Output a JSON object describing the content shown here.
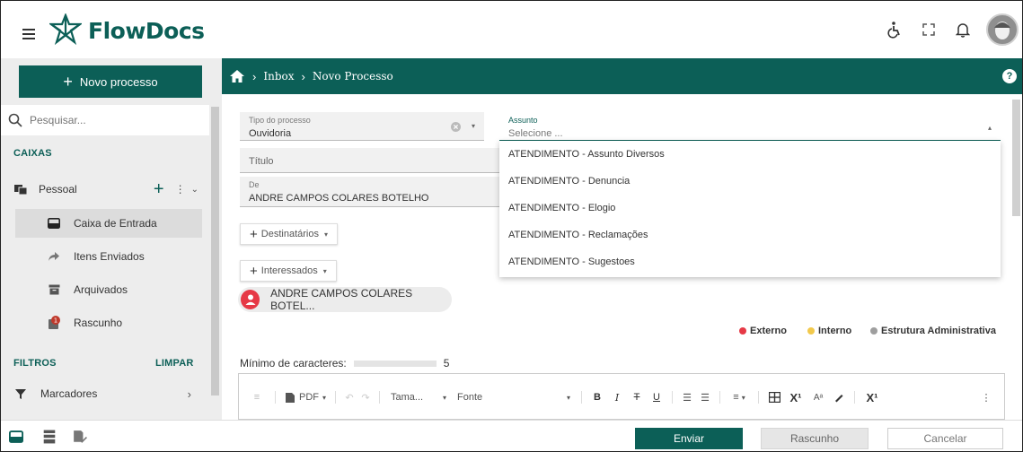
{
  "app": {
    "name": "FlowDocs"
  },
  "header": {
    "icons": [
      "accessibility-icon",
      "fullscreen-icon",
      "bell-icon",
      "user-avatar"
    ]
  },
  "sidebar": {
    "new_process_label": "Novo processo",
    "search_placeholder": "Pesquisar...",
    "caixas_title": "CAIXAS",
    "pessoal_label": "Pessoal",
    "items": [
      {
        "label": "Caixa de Entrada",
        "icon": "inbox-icon",
        "active": true
      },
      {
        "label": "Itens Enviados",
        "icon": "share-icon",
        "active": false
      },
      {
        "label": "Arquivados",
        "icon": "archive-icon",
        "active": false
      },
      {
        "label": "Rascunho",
        "icon": "draft-icon",
        "active": false,
        "badge": "1"
      }
    ],
    "filtros_title": "FILTROS",
    "limpar_label": "LIMPAR",
    "marcadores_label": "Marcadores"
  },
  "breadcrumb": {
    "items": [
      "Inbox",
      "Novo Processo"
    ],
    "help_label": "?"
  },
  "form": {
    "tipo_label": "Tipo do processo",
    "tipo_value": "Ouvidoria",
    "assunto_label": "Assunto",
    "assunto_placeholder": "Selecione ...",
    "titulo_placeholder": "Título",
    "de_label": "De",
    "de_value": "ANDRE CAMPOS COLARES BOTELHO",
    "destinatarios_label": "Destinatários",
    "interessados_label": "Interessados",
    "person_chip": "ANDRE CAMPOS COLARES BOTEL...",
    "legend": [
      {
        "label": "Externo",
        "color": "#e63946"
      },
      {
        "label": "Interno",
        "color": "#f2c94c"
      },
      {
        "label": "Estrutura Administrativa",
        "color": "#9e9e9e"
      }
    ],
    "min_chars_label": "Mínimo de caracteres:",
    "min_chars_value": "5"
  },
  "editor_toolbar": {
    "pdf_label": "PDF",
    "size_label": "Tama...",
    "font_label": "Fonte",
    "bold": "B",
    "italic": "I",
    "strike": "T",
    "underline": "U",
    "superscript": "X¹",
    "font_size_icon": "Aᵃ",
    "subscript": "X¹",
    "more": "⋮"
  },
  "assunto_options": [
    "ATENDIMENTO - Assunto Diversos",
    "ATENDIMENTO - Denuncia",
    "ATENDIMENTO - Elogio",
    "ATENDIMENTO - Reclamações",
    "ATENDIMENTO - Sugestoes"
  ],
  "footer": {
    "send_label": "Enviar",
    "draft_label": "Rascunho",
    "cancel_label": "Cancelar"
  },
  "colors": {
    "brand": "#0c5f57",
    "sidebar_bg": "#ededed",
    "field_bg": "#f1f1f1"
  }
}
